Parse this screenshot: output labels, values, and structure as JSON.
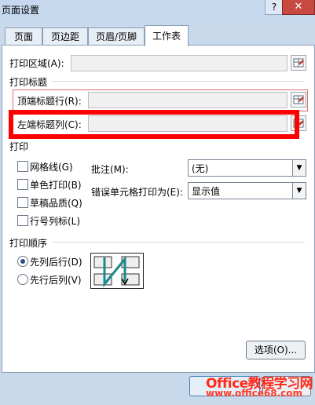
{
  "window": {
    "title": "页面设置",
    "help": "?",
    "close": "✕"
  },
  "tabs": [
    "页面",
    "页边距",
    "页眉/页脚",
    "工作表"
  ],
  "print_area": {
    "label": "打印区域(A):",
    "value": ""
  },
  "print_titles": {
    "section": "打印标题",
    "rows_label": "顶端标题行(R):",
    "cols_label": "左端标题列(C):"
  },
  "print": {
    "section": "打印",
    "gridlines": "网格线(G)",
    "mono": "单色打印(B)",
    "draft": "草稿品质(Q)",
    "headings": "行号列标(L)",
    "comments_label": "批注(M):",
    "comments_value": "(无)",
    "errors_label": "错误单元格打印为(E):",
    "errors_value": "显示值"
  },
  "page_order": {
    "section": "打印顺序",
    "down_then_over": "先列后行(D)",
    "over_then_down": "先行后列(V)"
  },
  "buttons": {
    "options": "选项(O)..."
  },
  "watermark": {
    "text": "Office教程学习网",
    "url": "www.office68.com"
  },
  "colors": {
    "highlight": "#ff0000",
    "tab_border": "#8c9fb8"
  }
}
